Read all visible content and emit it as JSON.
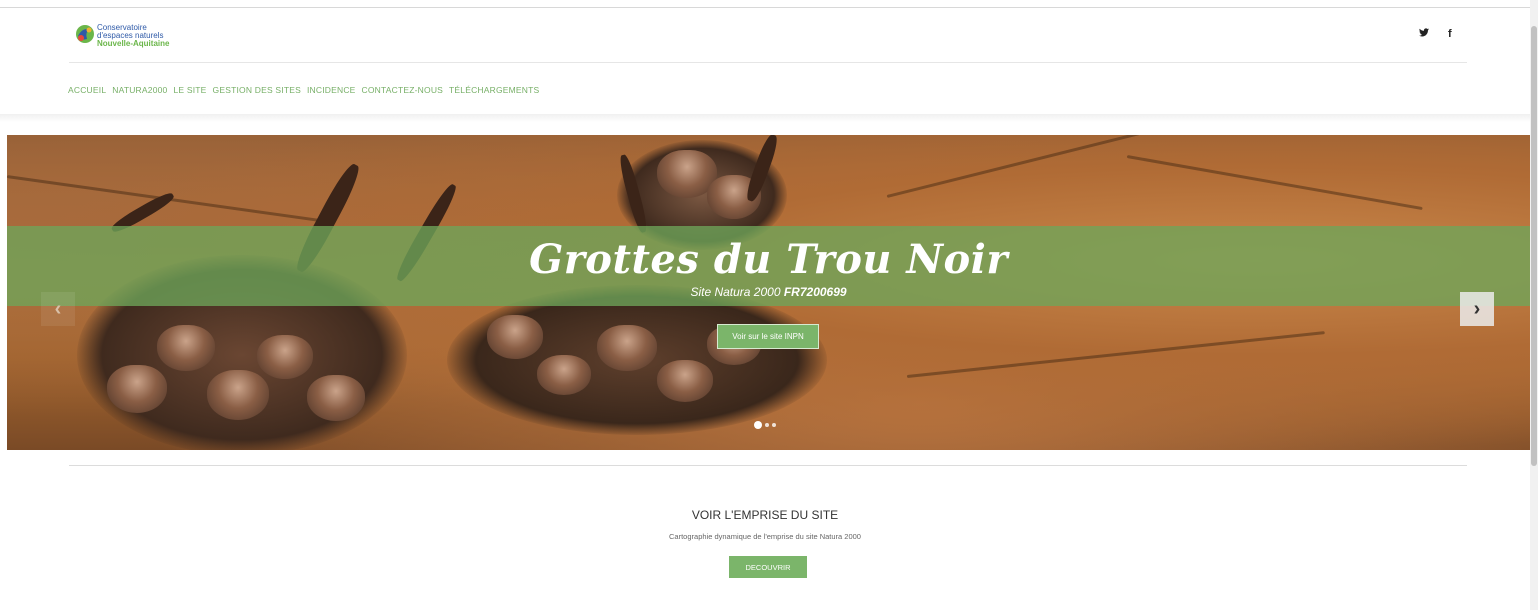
{
  "brand": {
    "line1": "Conservatoire",
    "line2": "d'espaces naturels",
    "line3": "Nouvelle-Aquitaine"
  },
  "social": {
    "twitter_glyph": "🐦",
    "facebook_glyph": "f"
  },
  "nav": [
    "ACCUEIL",
    "NATURA2000",
    "LE SITE",
    "GESTION DES SITES",
    "INCIDENCE",
    "CONTACTEZ-NOUS",
    "TÉLÉCHARGEMENTS"
  ],
  "hero": {
    "title": "Grottes du Trou Noir",
    "subtitle_prefix": "Site Natura 2000 ",
    "subtitle_code": "FR7200699",
    "button_label": "Voir sur le site INPN",
    "arrow_left": "‹",
    "arrow_right": "›",
    "slide_count": 3,
    "active_slide": 1
  },
  "section": {
    "title": "VOIR L'EMPRISE DU SITE",
    "description": "Cartographie dynamique de l'emprise du site Natura 2000",
    "button_label": "DECOUVRIR"
  },
  "colors": {
    "accent": "#7bb56a",
    "nav_text": "#78b068",
    "logo_blue": "#2f5aa8",
    "logo_green": "#6bb64a"
  }
}
